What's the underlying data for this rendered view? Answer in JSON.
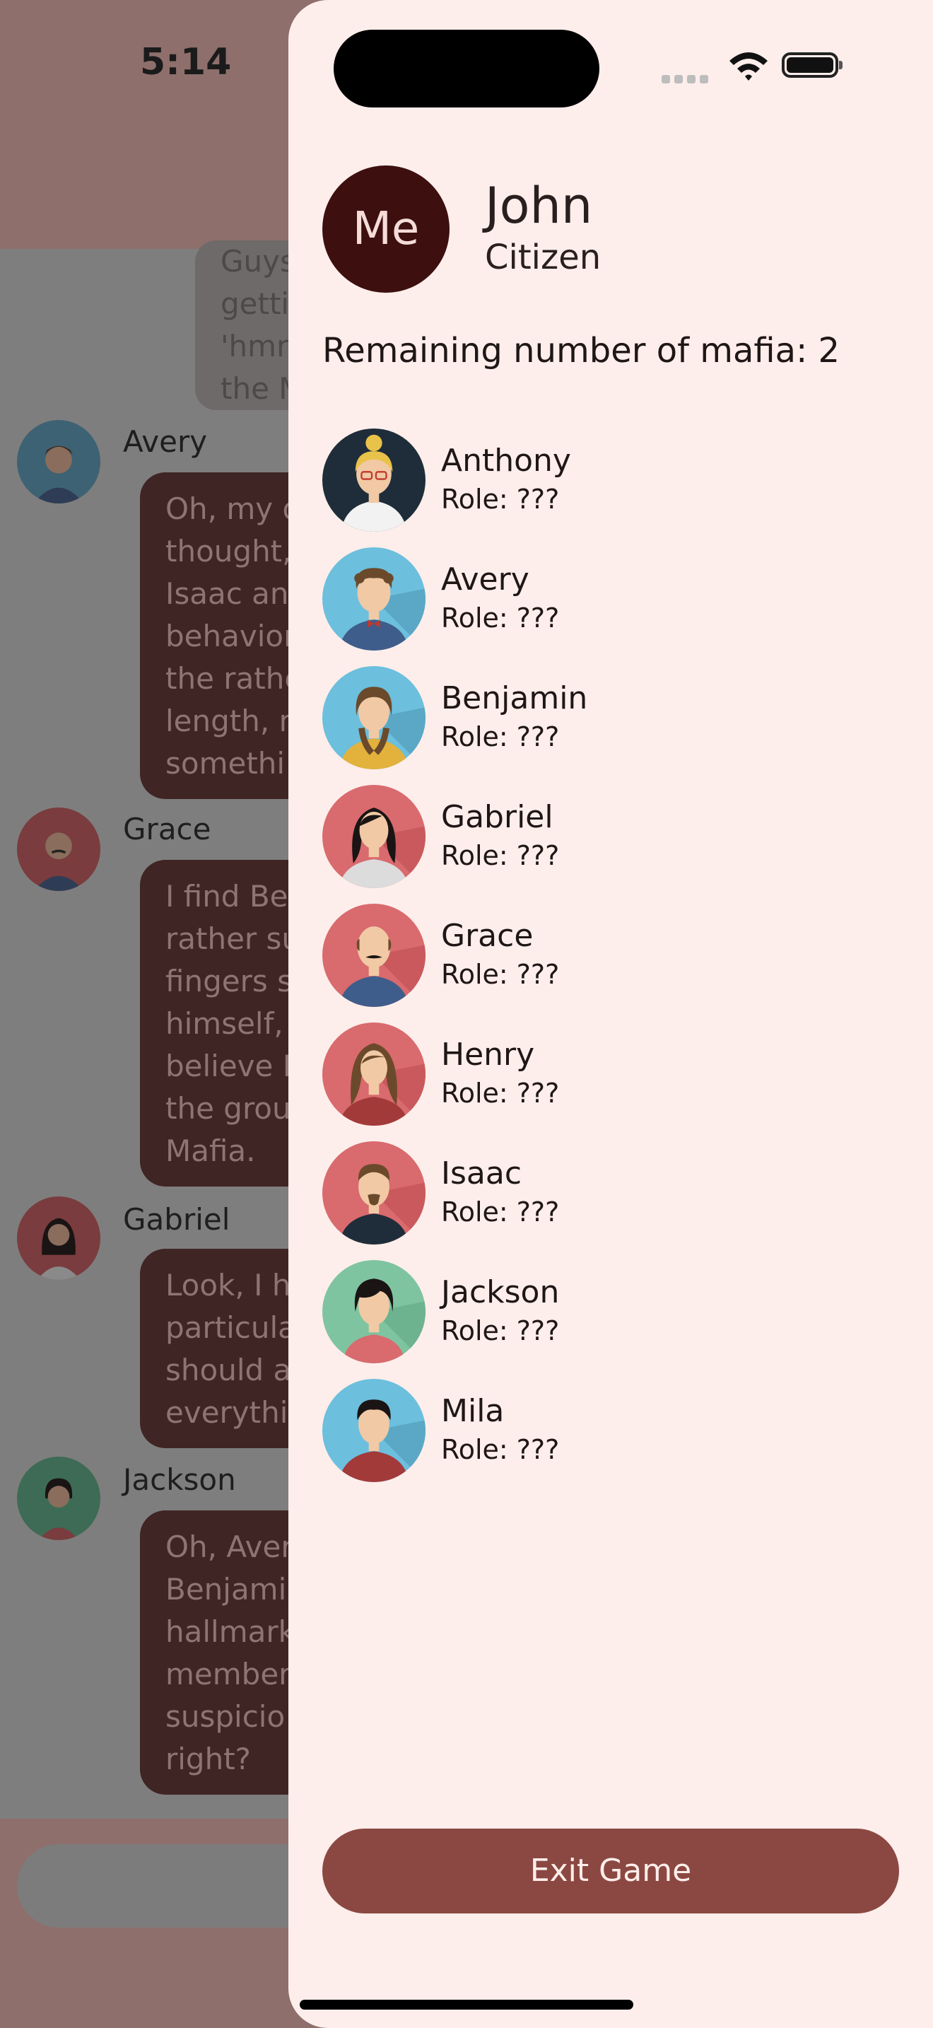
{
  "status_bar": {
    "time": "5:14"
  },
  "background_chat": {
    "first_bubble_lines": [
      "Guys",
      "getti",
      "'hmn",
      "the M"
    ],
    "messages": [
      {
        "name": "Avery",
        "text": "Oh, my d\nthought,\nIsaac an\nbehavior\nthe rathe\nlength, n\nsomethi"
      },
      {
        "name": "Grace",
        "text": "I find Be\nrather su\nfingers s\nhimself,\nbelieve B\nthe grou\nMafia."
      },
      {
        "name": "Gabriel",
        "text": "Look, I h\nparticula\nshould a\neverythi"
      },
      {
        "name": "Jackson",
        "text": "Oh, Aver\nBenjami\nhallmark\nmember\nsuspicio\nright?"
      }
    ]
  },
  "drawer": {
    "me": {
      "avatar_label": "Me",
      "name": "John",
      "role": "Citizen"
    },
    "mafia_remaining": "Remaining number of mafia: 2",
    "players": [
      {
        "name": "Anthony",
        "role": "Role: ???",
        "avatar": "blonde-woman-glasses-avatar",
        "bg": "#1f2d3a"
      },
      {
        "name": "Avery",
        "role": "Role: ???",
        "avatar": "curly-man-bowtie-avatar",
        "bg": "#6cbfdd"
      },
      {
        "name": "Benjamin",
        "role": "Role: ???",
        "avatar": "braided-woman-avatar",
        "bg": "#6cbfdd"
      },
      {
        "name": "Gabriel",
        "role": "Role: ???",
        "avatar": "long-hair-woman-avatar",
        "bg": "#d96a6e"
      },
      {
        "name": "Grace",
        "role": "Role: ???",
        "avatar": "bald-mustache-man-avatar",
        "bg": "#d96a6e"
      },
      {
        "name": "Henry",
        "role": "Role: ???",
        "avatar": "wavy-hair-woman-avatar",
        "bg": "#d96a6e"
      },
      {
        "name": "Isaac",
        "role": "Role: ???",
        "avatar": "bearded-man-avatar",
        "bg": "#d96a6e"
      },
      {
        "name": "Jackson",
        "role": "Role: ???",
        "avatar": "short-hair-woman-avatar",
        "bg": "#7fc4a1"
      },
      {
        "name": "Mila",
        "role": "Role: ???",
        "avatar": "dark-hair-man-avatar",
        "bg": "#6cbfdd"
      }
    ],
    "exit_label": "Exit Game"
  },
  "colors": {
    "accent": "#8b4842",
    "drawer_bg": "#fdeeeb",
    "me_avatar_bg": "#3d0f0f"
  }
}
